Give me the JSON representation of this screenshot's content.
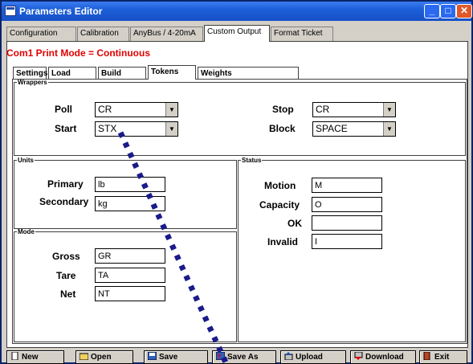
{
  "window": {
    "title": "Parameters Editor",
    "controls": [
      "minimize",
      "maximize",
      "close"
    ]
  },
  "tabs": [
    {
      "label": "Configuration",
      "active": false
    },
    {
      "label": "Calibration",
      "active": false
    },
    {
      "label": "AnyBus / 4-20mA",
      "active": false
    },
    {
      "label": "Custom Output",
      "active": true
    },
    {
      "label": "Format Ticket",
      "active": false
    }
  ],
  "mode_line": "Com1 Print Mode = Continuous",
  "subtabs": [
    {
      "label": "Settings",
      "active": false
    },
    {
      "label": "Load",
      "active": false
    },
    {
      "label": "Build",
      "active": false
    },
    {
      "label": "Tokens",
      "active": true
    },
    {
      "label": "Weights",
      "active": false
    }
  ],
  "wrappers": {
    "legend": "Wrappers",
    "poll": {
      "label": "Poll",
      "value": "CR"
    },
    "start": {
      "label": "Start",
      "value": "STX"
    },
    "stop": {
      "label": "Stop",
      "value": "CR"
    },
    "block": {
      "label": "Block",
      "value": "SPACE"
    }
  },
  "units": {
    "legend": "Units",
    "primary": {
      "label": "Primary",
      "value": "lb"
    },
    "secondary": {
      "label": "Secondary",
      "value": "kg"
    }
  },
  "mode": {
    "legend": "Mode",
    "gross": {
      "label": "Gross",
      "value": "GR"
    },
    "tare": {
      "label": "Tare",
      "value": "TA"
    },
    "net": {
      "label": "Net",
      "value": "NT"
    }
  },
  "status": {
    "legend": "Status",
    "motion": {
      "label": "Motion",
      "value": "M"
    },
    "capacity": {
      "label": "Capacity",
      "value": "O"
    },
    "ok": {
      "label": "OK",
      "value": ""
    },
    "invalid": {
      "label": "Invalid",
      "value": "I"
    }
  },
  "buttons": [
    {
      "label": "New",
      "icon": "new-document-icon"
    },
    {
      "label": "Open",
      "icon": "open-folder-icon"
    },
    {
      "label": "Save",
      "icon": "save-disk-icon"
    },
    {
      "label": "Save As",
      "icon": "save-as-icon"
    },
    {
      "label": "Upload",
      "icon": "upload-icon"
    },
    {
      "label": "Download",
      "icon": "download-icon"
    },
    {
      "label": "Exit",
      "icon": "exit-door-icon"
    }
  ],
  "colors": {
    "mode_text": "#e00000",
    "titlebar": "#1d5fd8",
    "dotted_trace": "#1a1a8a"
  }
}
